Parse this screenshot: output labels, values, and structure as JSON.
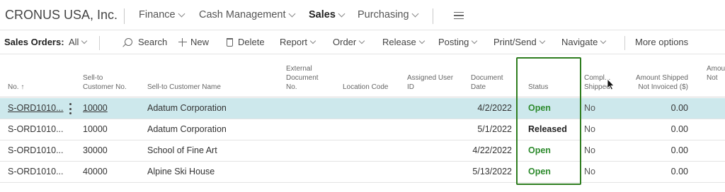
{
  "app": {
    "company": "CRONUS USA, Inc.",
    "nav": [
      "Finance",
      "Cash Management",
      "Sales",
      "Purchasing"
    ]
  },
  "actionbar": {
    "page_label": "Sales Orders:",
    "filter": "All",
    "search": "Search",
    "new": "New",
    "delete": "Delete",
    "report": "Report",
    "order": "Order",
    "release": "Release",
    "posting": "Posting",
    "print_send": "Print/Send",
    "navigate": "Navigate",
    "more": "More options"
  },
  "table": {
    "headers": {
      "no": "No. ↑",
      "sell_to_no": "Sell-to\nCustomer No.",
      "sell_to_name": "Sell-to Customer Name",
      "ext_doc": "External\nDocument\nNo.",
      "location": "Location Code",
      "assigned": "Assigned User\nID",
      "doc_date": "Document\nDate",
      "status": "Status",
      "completely": "Compl...\nShipped",
      "amt_shipped": "Amount Shipped\nNot Invoiced ($)",
      "amt_next": "Amou\nNot"
    },
    "rows": [
      {
        "no": "S-ORD1010...",
        "cust_no": "10000",
        "name": "Adatum Corporation",
        "date": "4/2/2022",
        "status": "Open",
        "shipped": "No",
        "amount": "0.00"
      },
      {
        "no": "S-ORD1010...",
        "cust_no": "10000",
        "name": "Adatum Corporation",
        "date": "5/1/2022",
        "status": "Released",
        "shipped": "No",
        "amount": "0.00"
      },
      {
        "no": "S-ORD1010...",
        "cust_no": "30000",
        "name": "School of Fine Art",
        "date": "4/22/2022",
        "status": "Open",
        "shipped": "No",
        "amount": "0.00"
      },
      {
        "no": "S-ORD1010...",
        "cust_no": "40000",
        "name": "Alpine Ski House",
        "date": "5/13/2022",
        "status": "Open",
        "shipped": "No",
        "amount": "0.00"
      }
    ]
  },
  "colors": {
    "selected_row": "#cde8ec",
    "status_open": "#2e8b2e",
    "highlight_border": "#2e7d1f"
  }
}
